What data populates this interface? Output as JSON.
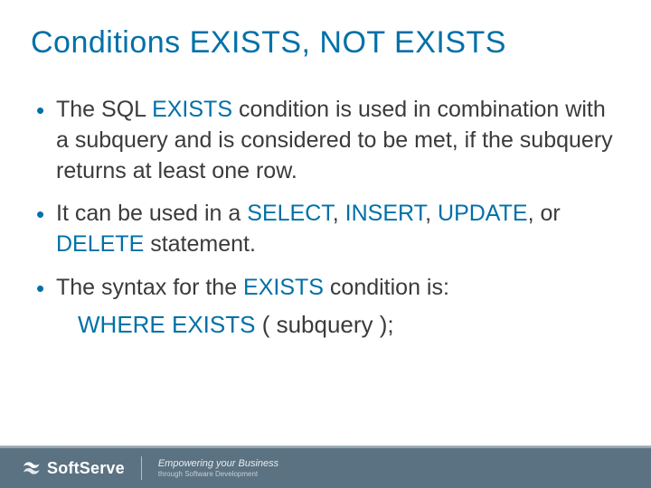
{
  "title": "Conditions EXISTS, NOT EXISTS",
  "bullets": [
    {
      "segments": [
        {
          "t": "The SQL "
        },
        {
          "t": "EXISTS",
          "kw": true
        },
        {
          "t": " condition is used in combination with a subquery and is considered to be met, if the subquery returns at least one row."
        }
      ]
    },
    {
      "segments": [
        {
          "t": "It can be used in a "
        },
        {
          "t": "SELECT",
          "kw": true
        },
        {
          "t": ", "
        },
        {
          "t": "INSERT",
          "kw": true
        },
        {
          "t": ", "
        },
        {
          "t": "UPDATE",
          "kw": true
        },
        {
          "t": ", or "
        },
        {
          "t": "DELETE",
          "kw": true
        },
        {
          "t": " statement."
        }
      ]
    },
    {
      "segments": [
        {
          "t": "The syntax for the "
        },
        {
          "t": "EXISTS",
          "kw": true
        },
        {
          "t": " condition is:"
        }
      ],
      "syntax": [
        {
          "t": "WHERE EXISTS ",
          "kw": true
        },
        {
          "t": "( subquery );"
        }
      ]
    }
  ],
  "footer": {
    "brand": "SoftServe",
    "tagline_main": "Empowering your Business",
    "tagline_sub": "through Software Development"
  }
}
